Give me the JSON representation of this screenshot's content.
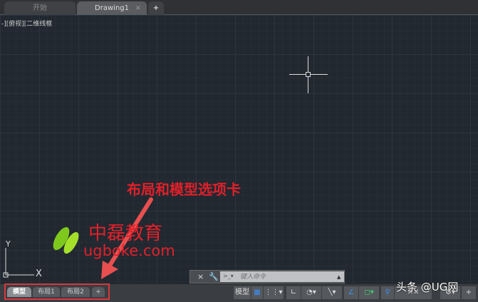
{
  "file_tabs": [
    {
      "label": "开始"
    },
    {
      "label": "Drawing1",
      "close": "×"
    }
  ],
  "new_tab": "+",
  "viewport_label": "-][俯视][二维线框",
  "annotation": "布局和模型选项卡",
  "watermark_brand": "中磊教育",
  "watermark_domain": "ugboke.com",
  "ucs": {
    "x": "X",
    "y": "Y"
  },
  "layout_tabs": [
    {
      "label": "模型",
      "active": true
    },
    {
      "label": "布局1"
    },
    {
      "label": "布局2"
    },
    {
      "label": "+"
    }
  ],
  "command_line": {
    "placeholder": "键入命令",
    "close": "×",
    "settings_icon": "wrench-icon"
  },
  "status_bar": {
    "model_label": "模型",
    "items": [
      "grid-icon",
      "snap-icon",
      "ortho-icon",
      "polar-icon",
      "osnap-track-icon",
      "isodraft-icon",
      "dynucs-icon",
      "annotation-icon",
      "scale-icon",
      "workspace-gear-icon",
      "customize-plus-icon"
    ]
  },
  "corner_watermark": "头条 @UG网",
  "colors": {
    "annotation": "#e0202a",
    "canvas": "#212830",
    "highlight_box": "#d8383a"
  }
}
